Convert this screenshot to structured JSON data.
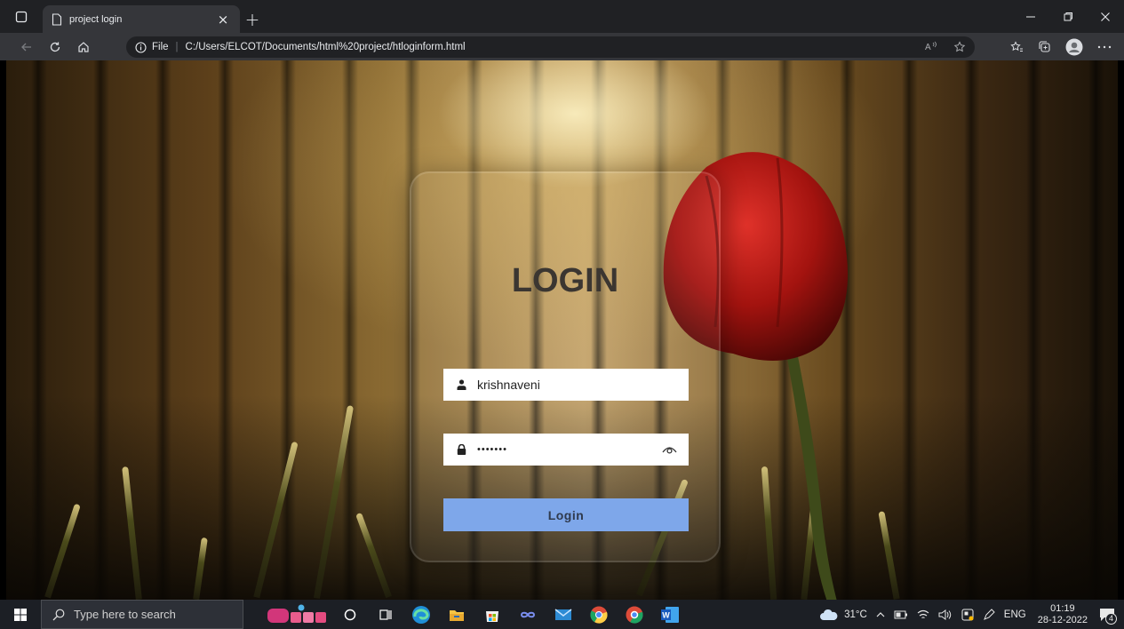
{
  "browser": {
    "tab_title": "project login",
    "tab_close": "×",
    "new_tab": "+",
    "address": {
      "info_label": "File",
      "url": "C:/Users/ELCOT/Documents/html%20project/htloginform.html"
    }
  },
  "login": {
    "title": "LOGIN",
    "username_value": "krishnaveni",
    "password_value": "•••••••",
    "button_label": "Login"
  },
  "taskbar": {
    "search_placeholder": "Type here to search",
    "weather": "31°C",
    "language": "ENG",
    "time": "01:19",
    "date": "28-12-2022",
    "notification_count": "4"
  },
  "icons": [
    "window-icon",
    "tab-page-icon",
    "back-icon",
    "refresh-icon",
    "home-icon",
    "info-icon",
    "read-aloud-icon",
    "favorite-add-icon",
    "favorites-icon",
    "collections-icon",
    "profile-icon",
    "more-icon",
    "user-icon",
    "lock-icon",
    "eye-icon",
    "windows-start-icon",
    "search-icon",
    "cortana-icon",
    "task-view-icon",
    "edge-icon",
    "file-explorer-icon",
    "store-icon",
    "mail-icon",
    "chrome-icon",
    "word-icon",
    "cloud-icon",
    "notification-icon"
  ],
  "colors": {
    "login_button": "#7ea7ea",
    "title_text": "#3b3631",
    "chrome_dark": "#202124",
    "chrome_toolbar": "#35363a"
  }
}
